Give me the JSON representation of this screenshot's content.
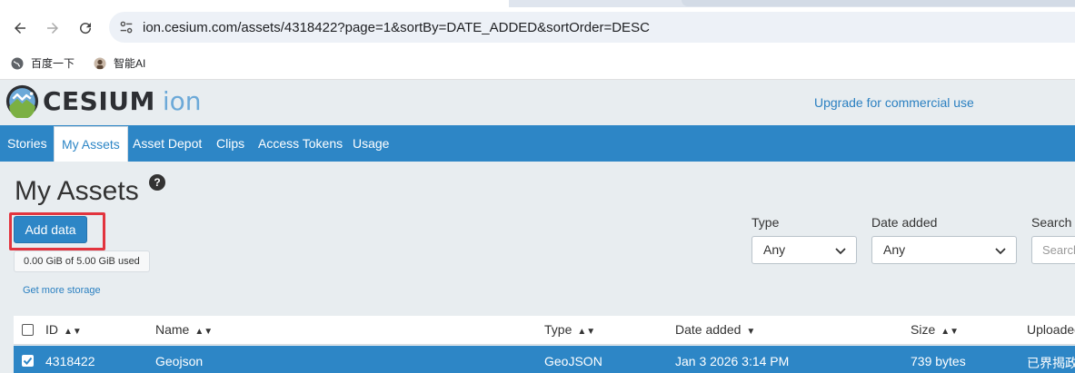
{
  "browser": {
    "url": "ion.cesium.com/assets/4318422?page=1&sortBy=DATE_ADDED&sortOrder=DESC",
    "bookmarks": [
      {
        "label": "百度一下",
        "icon": "globe-icon"
      },
      {
        "label": "智能AI",
        "icon": "avatar-icon"
      }
    ]
  },
  "header": {
    "logo_word": "CESIUM",
    "logo_suffix": "ion",
    "upgrade_link": "Upgrade for commercial use"
  },
  "nav": {
    "items": [
      "Stories",
      "My Assets",
      "Asset Depot",
      "Clips",
      "Access Tokens",
      "Usage"
    ],
    "active": "My Assets"
  },
  "main": {
    "title": "My Assets",
    "help_icon": "?",
    "add_button": "Add data",
    "storage_used": "0.00 GiB of 5.00 GiB used",
    "more_storage": "Get more storage"
  },
  "filters": {
    "type_label": "Type",
    "type_value": "Any",
    "date_label": "Date added",
    "date_value": "Any",
    "search_label": "Search",
    "search_placeholder": "Search"
  },
  "table": {
    "columns": [
      "ID",
      "Name",
      "Type",
      "Date added",
      "Size",
      "Uploaded"
    ],
    "rows": [
      {
        "id": "4318422",
        "name": "Geojson",
        "type": "GeoJSON",
        "date_added": "Jan 3 2026 3:14 PM",
        "size": "739 bytes",
        "uploaded": "已界揭政"
      }
    ]
  },
  "colors": {
    "nav_bg": "#2d86c6",
    "page_bg": "#e8edf0",
    "highlight": "#e2343e",
    "link": "#2b80c1"
  }
}
